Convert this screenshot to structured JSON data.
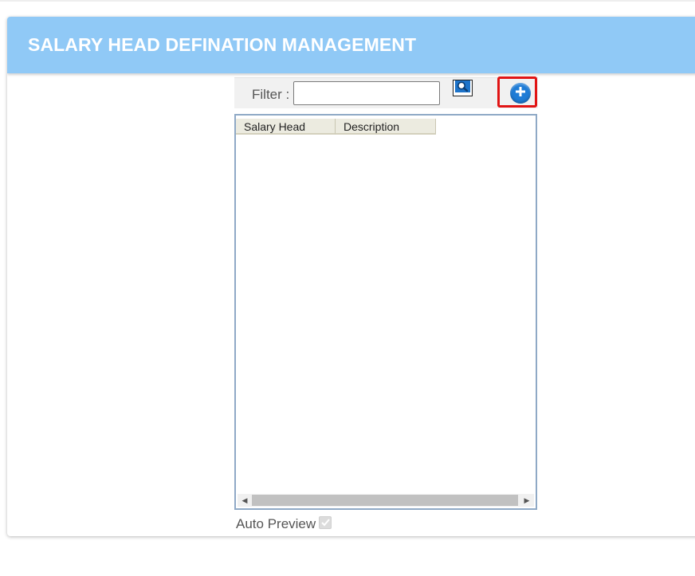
{
  "header": {
    "title": "SALARY HEAD DEFINATION MANAGEMENT"
  },
  "toolbar": {
    "filter_label": "Filter :",
    "filter_value": "",
    "search_icon": "magnifier-icon",
    "add_icon": "plus-circle-icon"
  },
  "grid": {
    "columns": [
      "Salary Head",
      "Description"
    ],
    "rows": []
  },
  "footer": {
    "auto_preview_label": "Auto Preview",
    "auto_preview_checked": true
  },
  "colors": {
    "header_bg": "#90c9f6",
    "add_button": "#1f7cd6",
    "highlight": "#e11414"
  }
}
